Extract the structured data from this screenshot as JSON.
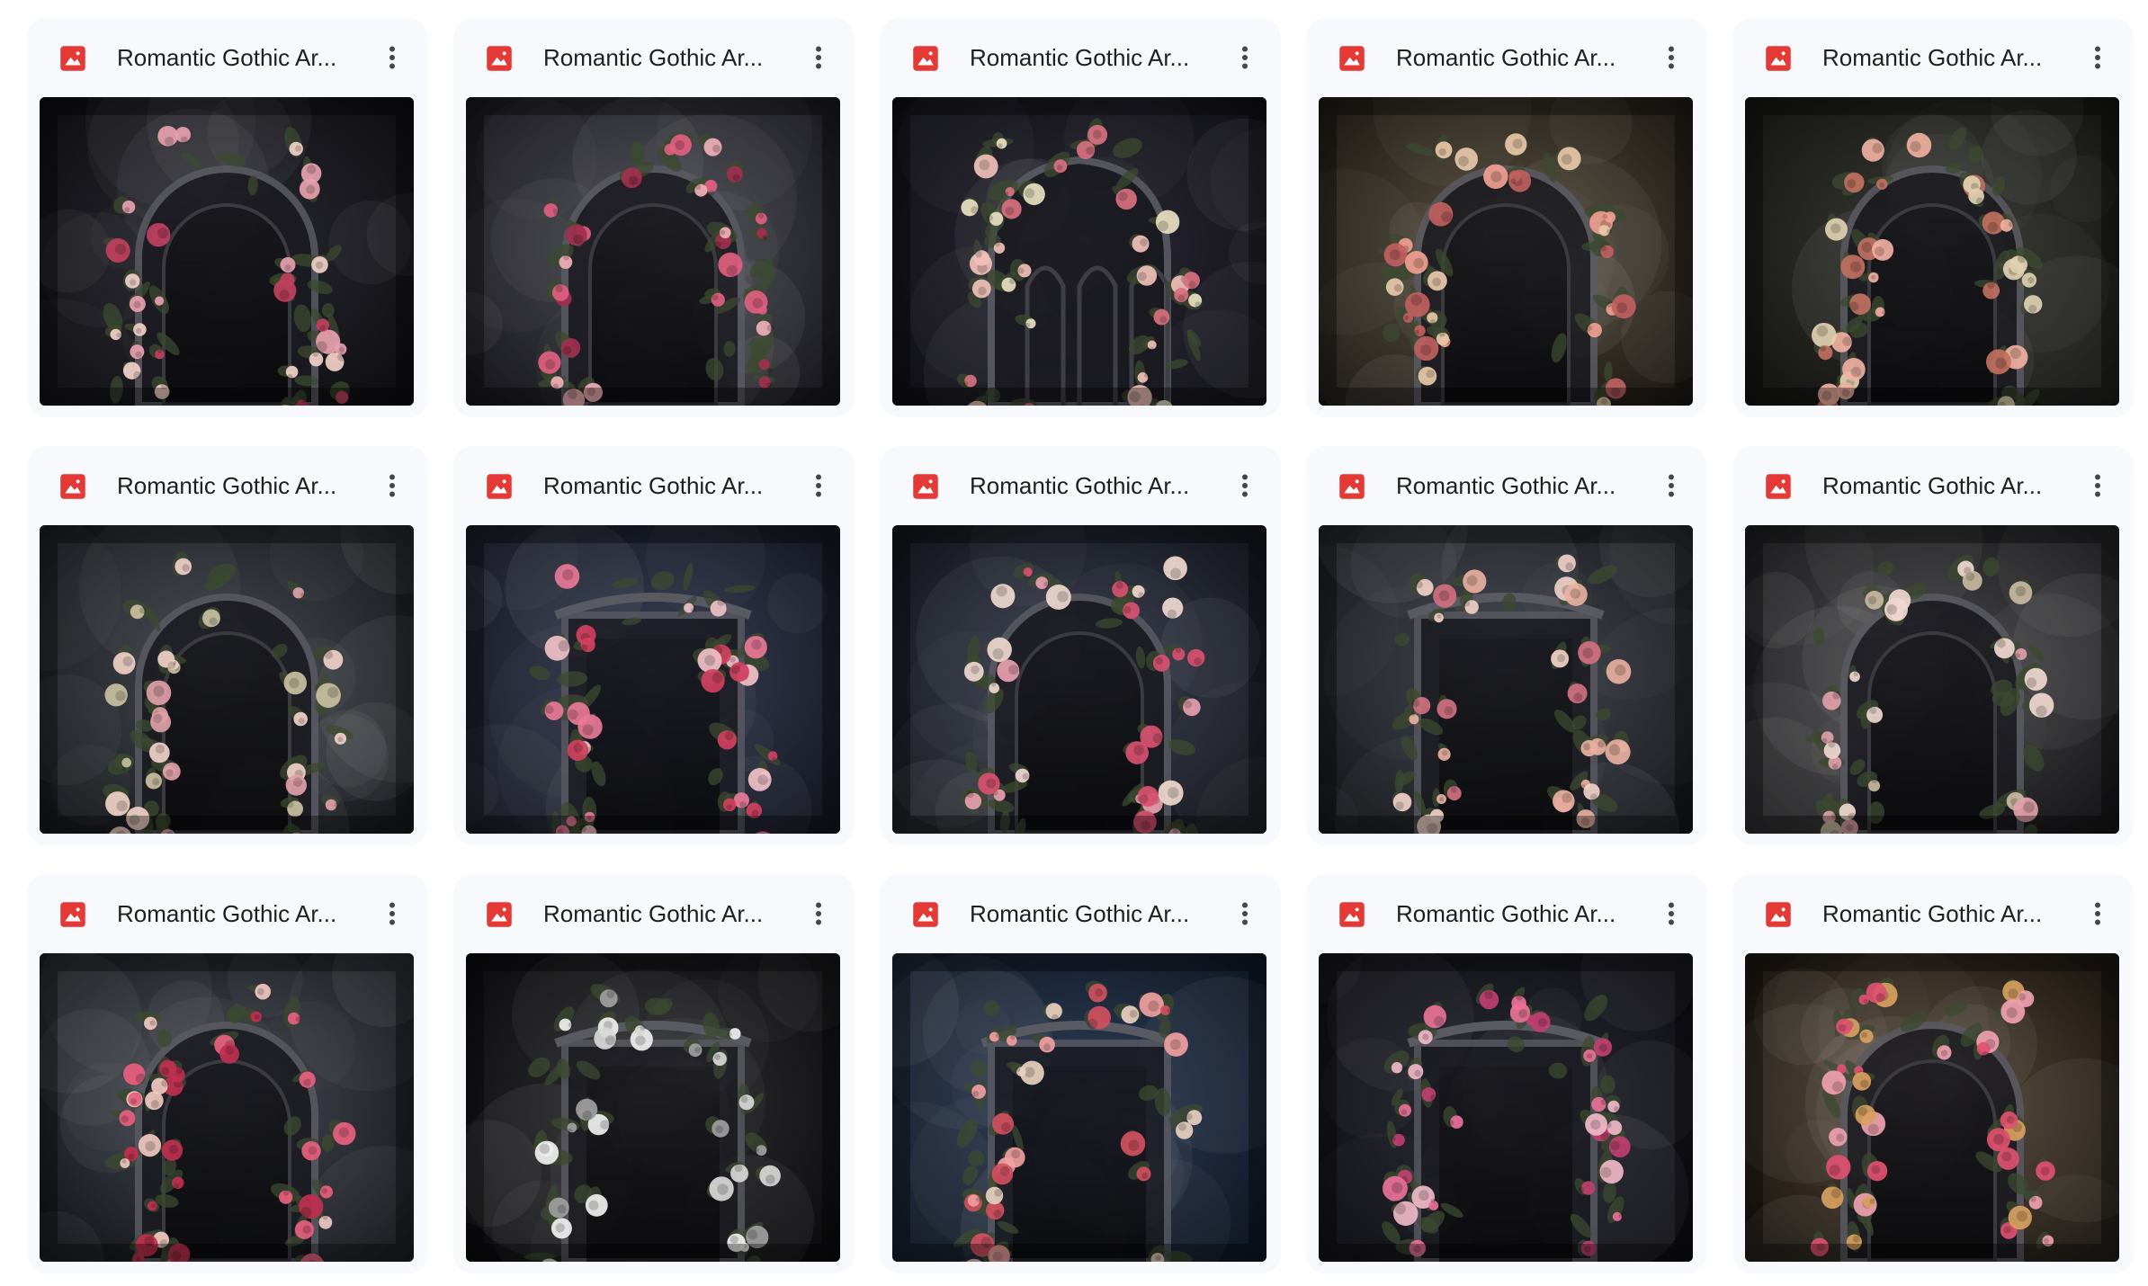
{
  "files": [
    {
      "name": "Romantic Gothic Ar...",
      "icon": "image-file-icon",
      "bg": [
        "#2a2a32",
        "#0c0c10"
      ],
      "flower": [
        "#e8a0b0",
        "#c04060",
        "#f2d0c8"
      ],
      "arch": "round"
    },
    {
      "name": "Romantic Gothic Ar...",
      "icon": "image-file-icon",
      "bg": [
        "#4a4a52",
        "#16161c"
      ],
      "flower": [
        "#e06080",
        "#f0b0b8",
        "#a03050"
      ],
      "arch": "round"
    },
    {
      "name": "Romantic Gothic Ar...",
      "icon": "image-file-icon",
      "bg": [
        "#2c2a36",
        "#0e0e14"
      ],
      "flower": [
        "#f0c0b8",
        "#d87080",
        "#e8e0c0"
      ],
      "arch": "pointed"
    },
    {
      "name": "Romantic Gothic Ar...",
      "icon": "image-file-icon",
      "bg": [
        "#5a5040",
        "#1a1612"
      ],
      "flower": [
        "#f0a090",
        "#e8c8a8",
        "#c06060"
      ],
      "arch": "round"
    },
    {
      "name": "Romantic Gothic Ar...",
      "icon": "image-file-icon",
      "bg": [
        "#3a3a36",
        "#121210"
      ],
      "flower": [
        "#f0b0a0",
        "#e0d0b0",
        "#c07060"
      ],
      "arch": "round"
    },
    {
      "name": "Romantic Gothic Ar...",
      "icon": "image-file-icon",
      "bg": [
        "#464a50",
        "#14161a"
      ],
      "flower": [
        "#f0d0c8",
        "#e0a0a8",
        "#c8c0a0"
      ],
      "arch": "round"
    },
    {
      "name": "Romantic Gothic Ar...",
      "icon": "image-file-icon",
      "bg": [
        "#3a4258",
        "#12141e"
      ],
      "flower": [
        "#e87898",
        "#f0c0c8",
        "#d04060"
      ],
      "arch": "square"
    },
    {
      "name": "Romantic Gothic Ar...",
      "icon": "image-file-icon",
      "bg": [
        "#3a4050",
        "#101218"
      ],
      "flower": [
        "#f0d8d0",
        "#d85070",
        "#e8a0b0"
      ],
      "arch": "round"
    },
    {
      "name": "Romantic Gothic Ar...",
      "icon": "image-file-icon",
      "bg": [
        "#40444c",
        "#121418"
      ],
      "flower": [
        "#f0d0c8",
        "#d07080",
        "#e8b0a0"
      ],
      "arch": "square"
    },
    {
      "name": "Romantic Gothic Ar...",
      "icon": "image-file-icon",
      "bg": [
        "#4a4a4c",
        "#141416"
      ],
      "flower": [
        "#f0d8d0",
        "#e0a0a8",
        "#c8b8a0"
      ],
      "arch": "round"
    },
    {
      "name": "Romantic Gothic Ar...",
      "icon": "image-file-icon",
      "bg": [
        "#484c56",
        "#101216"
      ],
      "flower": [
        "#e86080",
        "#f0c8c0",
        "#c03050"
      ],
      "arch": "round"
    },
    {
      "name": "Romantic Gothic Ar...",
      "icon": "image-file-icon",
      "bg": [
        "#303034",
        "#0a0a0c"
      ],
      "flower": [
        "#d8d8d8",
        "#a0a0a0",
        "#f0f0f0"
      ],
      "arch": "square"
    },
    {
      "name": "Romantic Gothic Ar...",
      "icon": "image-file-icon",
      "bg": [
        "#2e3e58",
        "#0e1420"
      ],
      "flower": [
        "#f0a0a0",
        "#e8d0c0",
        "#d05060"
      ],
      "arch": "square"
    },
    {
      "name": "Romantic Gothic Ar...",
      "icon": "image-file-icon",
      "bg": [
        "#2a2a34",
        "#0c0c12"
      ],
      "flower": [
        "#e87098",
        "#f0b8c8",
        "#c04070"
      ],
      "arch": "square"
    },
    {
      "name": "Romantic Gothic Ar...",
      "icon": "image-file-icon",
      "bg": [
        "#5a4a3a",
        "#16120e"
      ],
      "flower": [
        "#e05070",
        "#f0a0b0",
        "#d8a060"
      ],
      "arch": "round"
    }
  ],
  "more_icon": "more-vert-icon",
  "colors": {
    "card_bg": "#f7f9fc",
    "image_icon_red": "#e53935",
    "text": "#1f1f1f"
  }
}
